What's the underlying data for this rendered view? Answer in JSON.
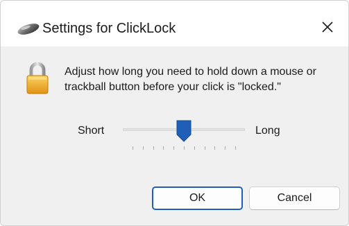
{
  "window": {
    "title": "Settings for ClickLock",
    "app_icon": "mouse-icon",
    "close_icon": "close-icon"
  },
  "content": {
    "icon": "padlock-icon",
    "description": "Adjust how long you need to hold down a mouse or trackball button before your click is \"locked.\""
  },
  "slider": {
    "min_label": "Short",
    "max_label": "Long",
    "value_fraction": 0.5,
    "tick_count": 11
  },
  "buttons": {
    "ok_label": "OK",
    "cancel_label": "Cancel"
  },
  "colors": {
    "accent": "#1c5fb5",
    "slider_thumb": "#1f5fb8",
    "lock_gold": "#e8a623"
  }
}
